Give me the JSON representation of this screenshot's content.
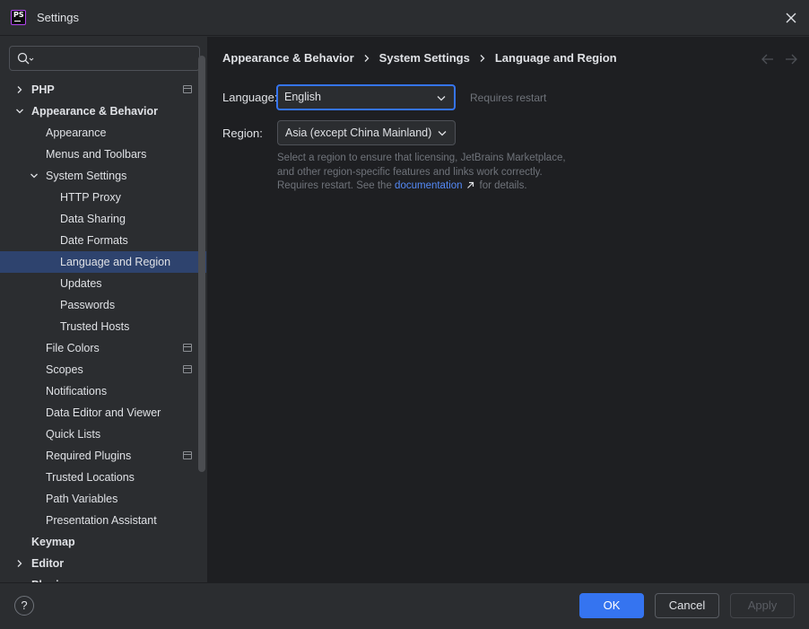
{
  "window": {
    "title": "Settings",
    "app_icon_label": "PS",
    "accent_color": "#3574f0",
    "selection_color": "#2e436e"
  },
  "sidebar": {
    "search_icon": "search-icon",
    "items": [
      {
        "label": "PHP",
        "level": 0,
        "chevron": "collapsed",
        "project_icon": true,
        "bold": true
      },
      {
        "label": "Appearance & Behavior",
        "level": 0,
        "chevron": "expanded",
        "project_icon": false,
        "bold": true
      },
      {
        "label": "Appearance",
        "level": 1,
        "chevron": "none",
        "project_icon": false,
        "bold": false
      },
      {
        "label": "Menus and Toolbars",
        "level": 1,
        "chevron": "none",
        "project_icon": false,
        "bold": false
      },
      {
        "label": "System Settings",
        "level": 1,
        "chevron": "expanded",
        "project_icon": false,
        "bold": false
      },
      {
        "label": "HTTP Proxy",
        "level": 2,
        "chevron": "none",
        "project_icon": false,
        "bold": false
      },
      {
        "label": "Data Sharing",
        "level": 2,
        "chevron": "none",
        "project_icon": false,
        "bold": false
      },
      {
        "label": "Date Formats",
        "level": 2,
        "chevron": "none",
        "project_icon": false,
        "bold": false
      },
      {
        "label": "Language and Region",
        "level": 2,
        "chevron": "none",
        "project_icon": false,
        "bold": false,
        "selected": true
      },
      {
        "label": "Updates",
        "level": 2,
        "chevron": "none",
        "project_icon": false,
        "bold": false
      },
      {
        "label": "Passwords",
        "level": 2,
        "chevron": "none",
        "project_icon": false,
        "bold": false
      },
      {
        "label": "Trusted Hosts",
        "level": 2,
        "chevron": "none",
        "project_icon": false,
        "bold": false
      },
      {
        "label": "File Colors",
        "level": 1,
        "chevron": "none",
        "project_icon": true,
        "bold": false
      },
      {
        "label": "Scopes",
        "level": 1,
        "chevron": "none",
        "project_icon": true,
        "bold": false
      },
      {
        "label": "Notifications",
        "level": 1,
        "chevron": "none",
        "project_icon": false,
        "bold": false
      },
      {
        "label": "Data Editor and Viewer",
        "level": 1,
        "chevron": "none",
        "project_icon": false,
        "bold": false
      },
      {
        "label": "Quick Lists",
        "level": 1,
        "chevron": "none",
        "project_icon": false,
        "bold": false
      },
      {
        "label": "Required Plugins",
        "level": 1,
        "chevron": "none",
        "project_icon": true,
        "bold": false
      },
      {
        "label": "Trusted Locations",
        "level": 1,
        "chevron": "none",
        "project_icon": false,
        "bold": false
      },
      {
        "label": "Path Variables",
        "level": 1,
        "chevron": "none",
        "project_icon": false,
        "bold": false
      },
      {
        "label": "Presentation Assistant",
        "level": 1,
        "chevron": "none",
        "project_icon": false,
        "bold": false
      },
      {
        "label": "Keymap",
        "level": 0,
        "chevron": "none",
        "project_icon": false,
        "bold": true
      },
      {
        "label": "Editor",
        "level": 0,
        "chevron": "collapsed",
        "project_icon": false,
        "bold": true
      },
      {
        "label": "Plugins",
        "level": 0,
        "chevron": "none",
        "project_icon": false,
        "bold": true
      }
    ]
  },
  "breadcrumb": [
    "Appearance & Behavior",
    "System Settings",
    "Language and Region"
  ],
  "form": {
    "language_label": "Language:",
    "language_value": "English",
    "language_hint": "Requires restart",
    "region_label": "Region:",
    "region_value": "Asia (except China Mainland)",
    "description_text": "Select a region to ensure that licensing, JetBrains Marketplace, and other region-specific features and links work correctly. Requires restart. See the",
    "description_link": "documentation",
    "description_suffix": "for details."
  },
  "footer": {
    "help_label": "?",
    "ok_label": "OK",
    "cancel_label": "Cancel",
    "apply_label": "Apply"
  }
}
